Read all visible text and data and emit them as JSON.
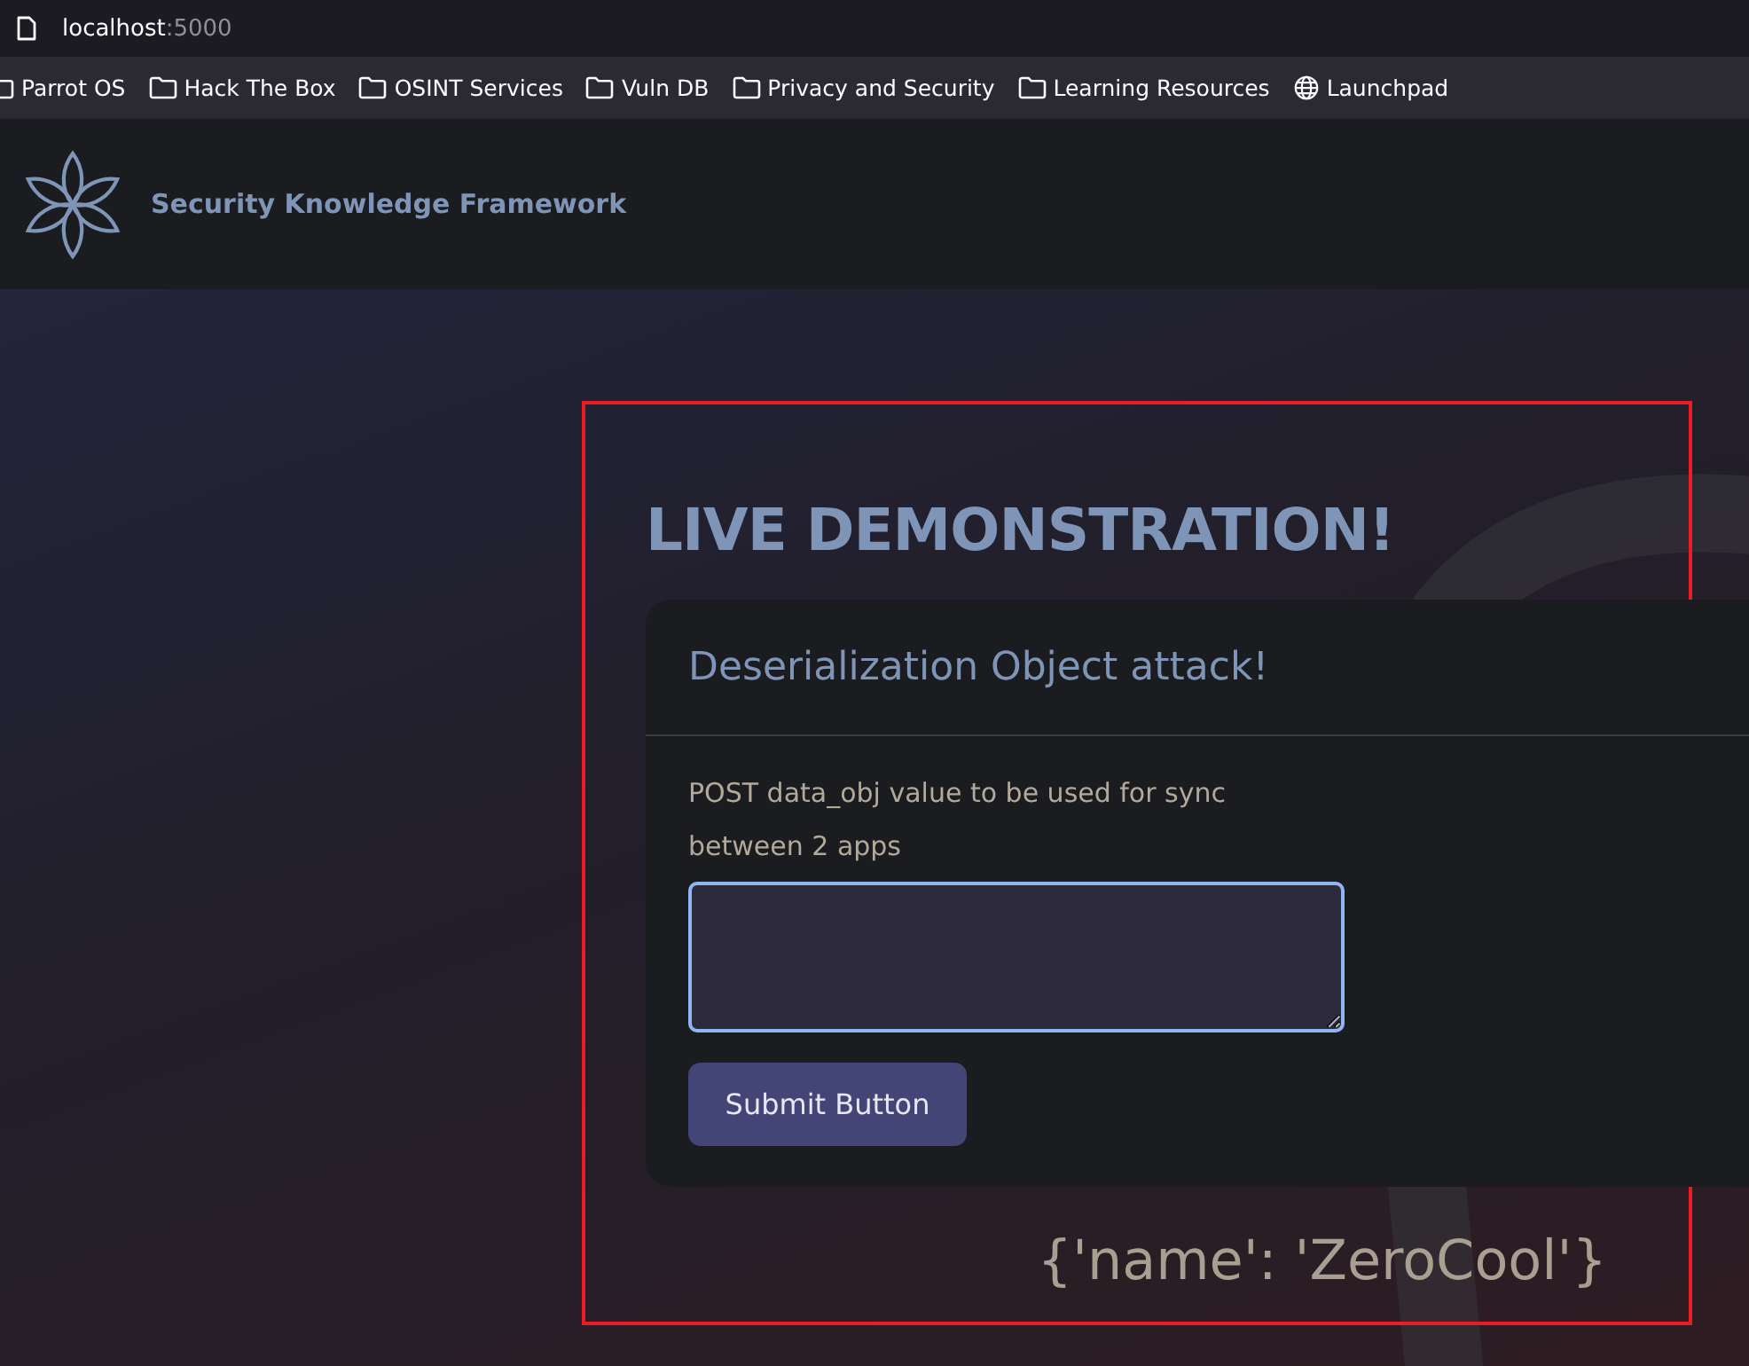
{
  "address_bar": {
    "host": "localhost",
    "port": ":5000"
  },
  "bookmarks": [
    {
      "label": "Parrot OS",
      "kind": "folder"
    },
    {
      "label": "Hack The Box",
      "kind": "folder"
    },
    {
      "label": "OSINT Services",
      "kind": "folder"
    },
    {
      "label": "Vuln DB",
      "kind": "folder"
    },
    {
      "label": "Privacy and Security",
      "kind": "folder"
    },
    {
      "label": "Learning Resources",
      "kind": "folder"
    },
    {
      "label": "Launchpad",
      "kind": "globe"
    }
  ],
  "header": {
    "title": "Security Knowledge Framework"
  },
  "main": {
    "heading": "LIVE DEMONSTRATION!",
    "card": {
      "title": "Deserialization Object attack!",
      "description": "POST data_obj value to be used for sync between 2 apps",
      "button": "Submit Button"
    },
    "output": "{'name': 'ZeroCool'}"
  }
}
